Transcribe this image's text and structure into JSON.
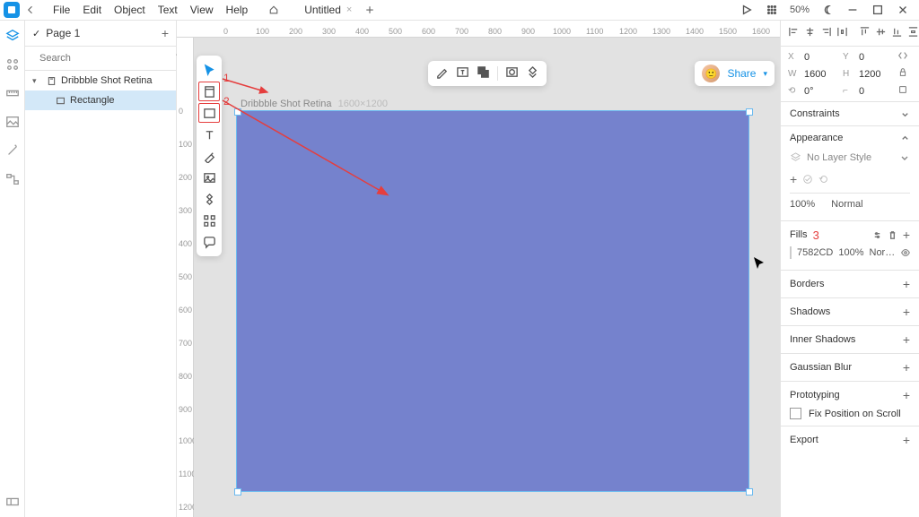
{
  "topbar": {
    "menu": [
      "File",
      "Edit",
      "Object",
      "Text",
      "View",
      "Help"
    ],
    "tab_title": "Untitled",
    "zoom": "50%"
  },
  "left": {
    "page": "Page 1",
    "search_placeholder": "Search",
    "layers": [
      {
        "name": "Dribbble Shot Retina",
        "selected": false,
        "expandable": true,
        "icon": "artboard"
      },
      {
        "name": "Rectangle",
        "selected": true,
        "expandable": false,
        "icon": "rect",
        "child": true
      }
    ]
  },
  "canvas": {
    "artboard_name": "Dribbble Shot Retina",
    "artboard_dims": "1600×1200",
    "ruler_h": [
      0,
      100,
      200,
      300,
      400,
      500,
      600,
      700,
      800,
      900,
      1000,
      1100,
      1200,
      1300,
      1400,
      1500,
      1600
    ],
    "ruler_v": [
      0,
      100,
      200,
      300,
      400,
      500,
      600,
      700,
      800,
      900,
      1000,
      1100,
      1200
    ],
    "annotations": {
      "a1": "1",
      "a2": "2",
      "a3": "3"
    },
    "share": "Share"
  },
  "right": {
    "x": "0",
    "y": "0",
    "w": "1600",
    "h": "1200",
    "rot": "0°",
    "sections": {
      "constraints": "Constraints",
      "appearance": "Appearance",
      "no_layer_style": "No Layer Style",
      "opacity": "100%",
      "blend": "Normal",
      "fills": "Fills",
      "fill_hex": "7582CD",
      "fill_opacity": "100%",
      "fill_blend": "Nor…",
      "borders": "Borders",
      "shadows": "Shadows",
      "inner_shadows": "Inner Shadows",
      "blur": "Gaussian Blur",
      "proto": "Prototyping",
      "fix": "Fix Position on Scroll",
      "export": "Export"
    }
  }
}
